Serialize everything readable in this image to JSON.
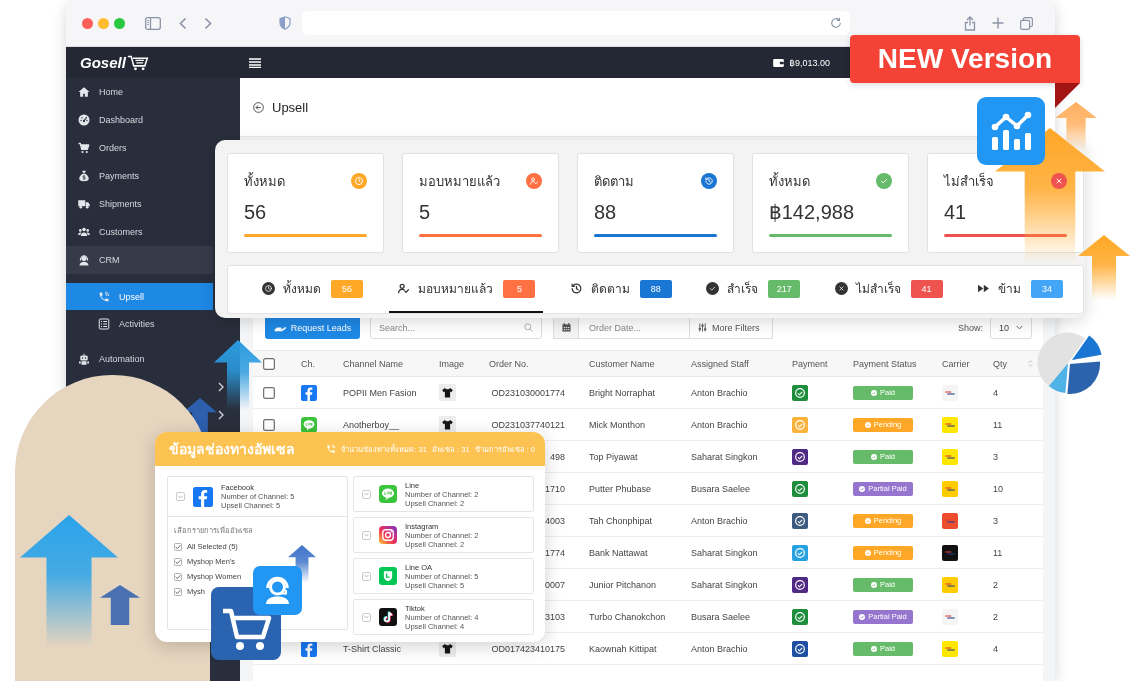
{
  "sidebar": {
    "logo": "Gosell",
    "items": [
      {
        "label": "Home",
        "selected": false
      },
      {
        "label": "Dashboard",
        "selected": false
      },
      {
        "label": "Orders",
        "selected": false
      },
      {
        "label": "Payments",
        "selected": false
      },
      {
        "label": "Shipments",
        "selected": false
      },
      {
        "label": "Customers",
        "selected": false
      },
      {
        "label": "CRM",
        "selected": false,
        "expanded": true,
        "children": [
          {
            "label": "Upsell",
            "selected": true
          },
          {
            "label": "Activities",
            "selected": false
          }
        ]
      },
      {
        "label": "Automation",
        "selected": false
      }
    ]
  },
  "topbar": {
    "balance": "฿9,013.00"
  },
  "page": {
    "title": "Upsell"
  },
  "summary_cards": [
    {
      "title": "ทั้งหมด",
      "value": "56",
      "color": "#ffa726"
    },
    {
      "title": "มอบหมายแล้ว",
      "value": "5",
      "color": "#ff7043"
    },
    {
      "title": "ติดตาม",
      "value": "88",
      "color": "#1976d2"
    },
    {
      "title": "ทั้งหมด",
      "value": "฿142,988",
      "color": "#66bb6a"
    },
    {
      "title": "ไม่สำเร็จ",
      "value": "41",
      "color": "#ef5350"
    }
  ],
  "status_tabs": [
    {
      "label": "ทั้งหมด",
      "count": "56",
      "color": "#ffa726",
      "selected": false
    },
    {
      "label": "มอบหมายแล้ว",
      "count": "5",
      "color": "#ff7043",
      "selected": true
    },
    {
      "label": "ติดตาม",
      "count": "88",
      "color": "#1976d2",
      "selected": false
    },
    {
      "label": "สำเร็จ",
      "count": "217",
      "color": "#66bb6a",
      "selected": false
    },
    {
      "label": "ไม่สำเร็จ",
      "count": "41",
      "color": "#ef5350",
      "selected": false
    },
    {
      "label": "ข้าม",
      "count": "34",
      "color": "#42a5f5",
      "selected": false
    }
  ],
  "toolbar": {
    "request_button": "Request Leads",
    "search_placeholder": "Search...",
    "date_placeholder": "Order Date...",
    "filters_button": "More Filters",
    "show_label": "Show:",
    "page_size": "10"
  },
  "table": {
    "select_all_checked": false,
    "columns": [
      "Ch.",
      "Channel Name",
      "Image",
      "Order No.",
      "Customer Name",
      "Assigned Staff",
      "Payment",
      "Payment Status",
      "Carrier",
      "Qty"
    ],
    "rows": [
      {
        "checked": false,
        "channel": {
          "kind": "facebook"
        },
        "channel_name": "POPII Men Fasion",
        "image": {
          "kind": "shirt"
        },
        "order_no": "OD231030001774",
        "customer": "Bright Norraphat",
        "staff": "Anton Brachio",
        "payment": {
          "color": "#1e8e3e"
        },
        "payment_status": {
          "text": "Paid",
          "color": "#66bb6a"
        },
        "carrier": {
          "color": "#f5f5f5"
        },
        "qty": "4"
      },
      {
        "checked": false,
        "channel": {
          "kind": "line"
        },
        "channel_name": "Anotherboy__",
        "image": {
          "kind": "shirt"
        },
        "order_no": "OD231037740121",
        "customer": "Mick Monthon",
        "staff": "Anton Brachio",
        "payment": {
          "color": "#fbb33c"
        },
        "payment_status": {
          "text": "Pending",
          "color": "#ffa726"
        },
        "carrier": {
          "color": "#ffe600"
        },
        "qty": "11"
      },
      {
        "order_no": "498",
        "customer": "Top Piyawat",
        "staff": "Saharat Singkon",
        "payment": {
          "color": "#4e2a84"
        },
        "payment_status": {
          "text": "Paid",
          "color": "#66bb6a"
        },
        "carrier": {
          "color": "#ffe600"
        },
        "qty": "3"
      },
      {
        "order_no": "1710",
        "customer": "Putter Phubase",
        "staff": "Busara Saelee",
        "payment": {
          "color": "#1e8e3e"
        },
        "payment_status": {
          "text": "Partial Paid",
          "color": "#9575cd"
        },
        "carrier": {
          "color": "#ffcc00"
        },
        "qty": "10"
      },
      {
        "order_no": "4003",
        "customer": "Tah Chonphipat",
        "staff": "Anton Brachio",
        "payment": {
          "color": "#3d5a80"
        },
        "payment_status": {
          "text": "Pending",
          "color": "#ffa726"
        },
        "carrier": {
          "color": "#ee4d2d"
        },
        "qty": "3"
      },
      {
        "order_no": "1774",
        "customer": "Bank Nattawat",
        "staff": "Saharat Singkon",
        "payment": {
          "color": "#29a3e0"
        },
        "payment_status": {
          "text": "Pending",
          "color": "#ffa726"
        },
        "carrier": {
          "color": "#111111"
        },
        "qty": "11"
      },
      {
        "order_no": "0007",
        "customer": "Junior Pitchanon",
        "staff": "Saharat Singkon",
        "payment": {
          "color": "#4e2a84"
        },
        "payment_status": {
          "text": "Paid",
          "color": "#66bb6a"
        },
        "carrier": {
          "color": "#ffcc00"
        },
        "qty": "2"
      },
      {
        "order_no": "3103",
        "customer": "Turbo Chanokchon",
        "staff": "Busara Saelee",
        "payment": {
          "color": "#1e8e3e"
        },
        "payment_status": {
          "text": "Partial Paid",
          "color": "#9575cd"
        },
        "carrier": {
          "color": "#f5f5f5"
        },
        "qty": "2"
      },
      {
        "channel": {
          "kind": "facebook"
        },
        "channel_name": "T-Shirt Classic",
        "image": {
          "kind": "shirt"
        },
        "order_no": "OD017423410175",
        "customer": "Kaownah Kittipat",
        "staff": "Anton Brachio",
        "payment": {
          "color": "#1e4fa0"
        },
        "payment_status": {
          "text": "Paid",
          "color": "#66bb6a"
        },
        "carrier": {
          "color": "#ffe600"
        },
        "qty": "4"
      }
    ]
  },
  "upsell_popup": {
    "title": "ข้อมูลช่องทางอัพเซล",
    "summary": [
      "จำนวนช่องทางทั้งหมด: 31",
      "อัพเซล : 31",
      "ข้ามการอัพเซล : 0"
    ],
    "channels": [
      {
        "kind": "facebook",
        "name": "Facebook",
        "channel_count": "Number of Channel: 5",
        "upsell_count": "Upsell Channel: 5",
        "expanded": true,
        "select_label": "เลือกรายการเพื่ออัพเซล",
        "options": [
          {
            "label": "All Selected (5)",
            "checked": true
          },
          {
            "label": "Myshop Men's",
            "checked": true
          },
          {
            "label": "Myshop Women",
            "checked": true
          },
          {
            "label": "Mysh",
            "checked": true
          }
        ]
      },
      {
        "kind": "line",
        "name": "Line",
        "channel_count": "Number of Channel: 2",
        "upsell_count": "Upsell Channel: 2",
        "expanded": false
      },
      {
        "kind": "instagram",
        "name": "Instagram",
        "channel_count": "Number of Channel: 2",
        "upsell_count": "Upsell Channel: 2",
        "expanded": false
      },
      {
        "kind": "line-oa",
        "name": "Line OA",
        "channel_count": "Number of Channel: 5",
        "upsell_count": "Upsell Channel: 5",
        "expanded": false
      },
      {
        "kind": "tiktok",
        "name": "Tiktok",
        "channel_count": "Number of Channel: 4",
        "upsell_count": "Upsell Channel: 4",
        "expanded": false
      }
    ]
  },
  "ribbon": {
    "text": "NEW Version"
  }
}
